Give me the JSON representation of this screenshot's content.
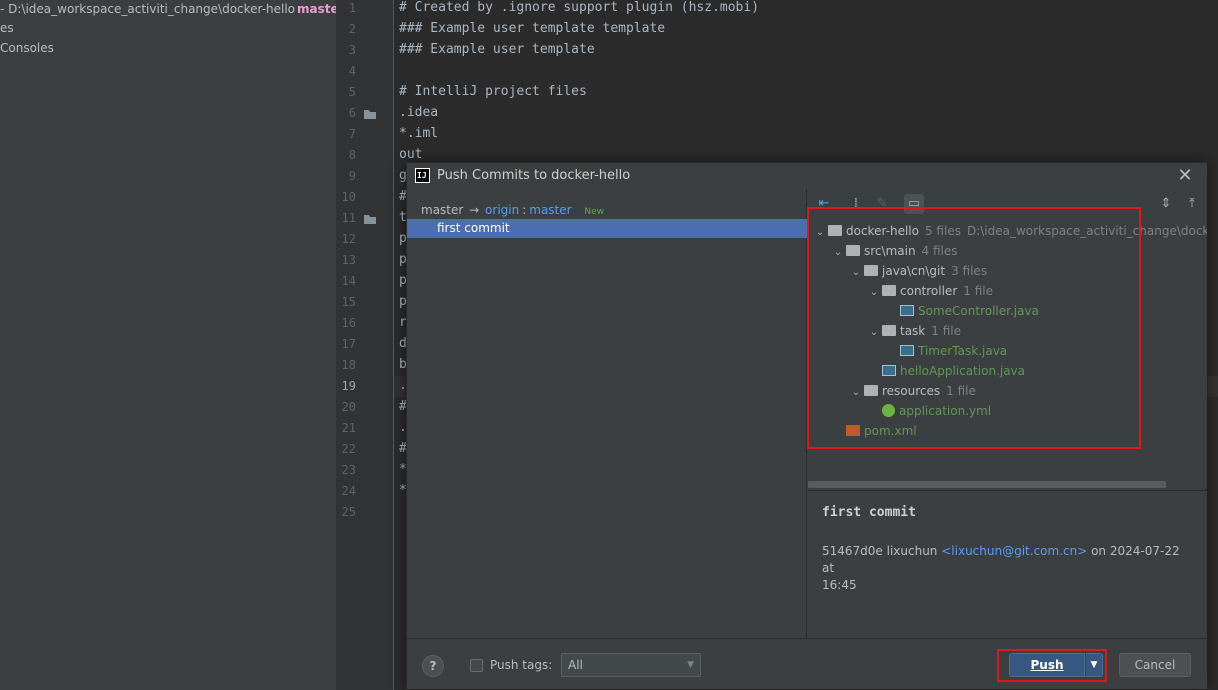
{
  "project_panel": {
    "path": "- D:\\idea_workspace_activiti_change\\docker-hello",
    "branch": "master/",
    "items": [
      "es",
      "Consoles"
    ]
  },
  "editor": {
    "line_numbers": [
      "1",
      "2",
      "3",
      "4",
      "5",
      "6",
      "7",
      "8",
      "9",
      "10",
      "11",
      "12",
      "13",
      "14",
      "15",
      "16",
      "17",
      "18",
      "19",
      "20",
      "21",
      "22",
      "23",
      "24",
      "25"
    ],
    "current_line": "19",
    "lines": [
      "# Created by .ignore support plugin (hsz.mobi)",
      "### Example user template template",
      "### Example user template",
      "",
      "# IntelliJ project files",
      ".idea",
      "*.iml",
      "out",
      "g",
      "#",
      "t",
      "p",
      "p",
      "p",
      "p",
      "r",
      "d",
      "b",
      ".",
      "#",
      ".",
      "#",
      "*",
      "*",
      ""
    ]
  },
  "dialog": {
    "title": "Push Commits to docker-hello",
    "close_icon": "close-icon",
    "repo": {
      "local_branch": "master",
      "arrow": "→",
      "remote": "origin",
      "separator": ":",
      "remote_branch": "master",
      "badge": "New"
    },
    "commit_subject": "first commit",
    "toolbar": [
      "arrow-left-icon",
      "group-by-icon",
      "edit-icon",
      "preview-diff-icon",
      "expand-all-icon",
      "collapse-all-icon"
    ],
    "tree": [
      {
        "name": "docker-hello",
        "count": "5 files",
        "extra": "D:\\idea_workspace_activiti_change\\docker-hello",
        "icon": "module-folder-icon",
        "chev": "⌄"
      },
      {
        "name": "src\\main",
        "count": "4 files",
        "icon": "folder-icon",
        "chev": "⌄"
      },
      {
        "name": "java\\cn\\git",
        "count": "3 files",
        "icon": "folder-icon",
        "chev": "⌄"
      },
      {
        "name": "controller",
        "count": "1 file",
        "icon": "folder-icon",
        "chev": "⌄"
      },
      {
        "name": "SomeController.java",
        "count": "",
        "icon": "java-class-icon",
        "chev": ""
      },
      {
        "name": "task",
        "count": "1 file",
        "icon": "folder-icon",
        "chev": "⌄"
      },
      {
        "name": "TimerTask.java",
        "count": "",
        "icon": "java-class-icon",
        "chev": ""
      },
      {
        "name": "helloApplication.java",
        "count": "",
        "icon": "java-class-icon",
        "chev": ""
      },
      {
        "name": "resources",
        "count": "1 file",
        "icon": "folder-icon",
        "chev": "⌄"
      },
      {
        "name": "application.yml",
        "count": "",
        "icon": "spring-icon",
        "chev": ""
      },
      {
        "name": "pom.xml",
        "count": "",
        "icon": "maven-icon",
        "chev": ""
      }
    ],
    "details": {
      "message": "first commit",
      "hash_author": "51467d0e lixuchun",
      "email": "<lixuchun@git.com.cn>",
      "date_prefix": "on 2024-07-22 at",
      "time": "16:45"
    },
    "footer": {
      "help": "?",
      "push_tags_label": "Push tags:",
      "tags_value": "All",
      "push_label": "Push",
      "cancel_label": "Cancel"
    }
  },
  "colors": {
    "accent": "#4b6eaf",
    "link": "#589df6",
    "added_file": "#629755",
    "highlight_box": "#e0171b",
    "branch": "#f29bd0"
  }
}
